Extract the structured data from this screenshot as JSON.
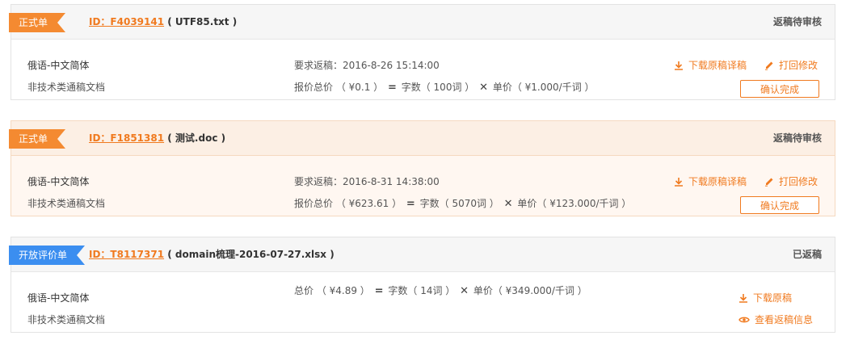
{
  "colors": {
    "accent": "#f07a1f",
    "tag_orange": "#f48a31",
    "tag_blue": "#3b8ef0",
    "highlight_bg": "#fff7f1"
  },
  "orders": [
    {
      "tag": "正式单",
      "id_label": "ID：F4039141",
      "filename": "( UTF85.txt )",
      "status": "返稿待审核",
      "language_pair": "俄语-中文简体",
      "doc_type": "非技术类通稿文档",
      "deadline": "要求返稿：2016-8-26 15:14:00",
      "price_total": "报价总价 （ ¥0.1 ）",
      "word_count": "字数（ 100词 ）",
      "unit_price": "单价（ ¥1.000/千词 ）",
      "download_label": "下载原稿译稿",
      "revise_label": "打回修改",
      "confirm_label": "确认完成"
    },
    {
      "tag": "正式单",
      "id_label": "ID：F1851381",
      "filename": "( 测试.doc )",
      "status": "返稿待审核",
      "language_pair": "俄语-中文简体",
      "doc_type": "非技术类通稿文档",
      "deadline": "要求返稿：2016-8-31 14:38:00",
      "price_total": "报价总价 （ ¥623.61 ）",
      "word_count": "字数（ 5070词 ）",
      "unit_price": "单价（ ¥123.000/千词 ）",
      "download_label": "下载原稿译稿",
      "revise_label": "打回修改",
      "confirm_label": "确认完成"
    },
    {
      "tag": "开放评价单",
      "id_label": "ID：T8117371",
      "filename": "( domain梳理-2016-07-27.xlsx )",
      "status": "已返稿",
      "language_pair": "俄语-中文简体",
      "doc_type": "非技术类通稿文档",
      "price_total": "总价 （ ¥4.89 ）",
      "word_count": "字数（ 14词 ）",
      "unit_price": "单价（ ¥349.000/千词 ）",
      "download_label": "下载原稿",
      "view_label": "查看返稿信息"
    }
  ]
}
